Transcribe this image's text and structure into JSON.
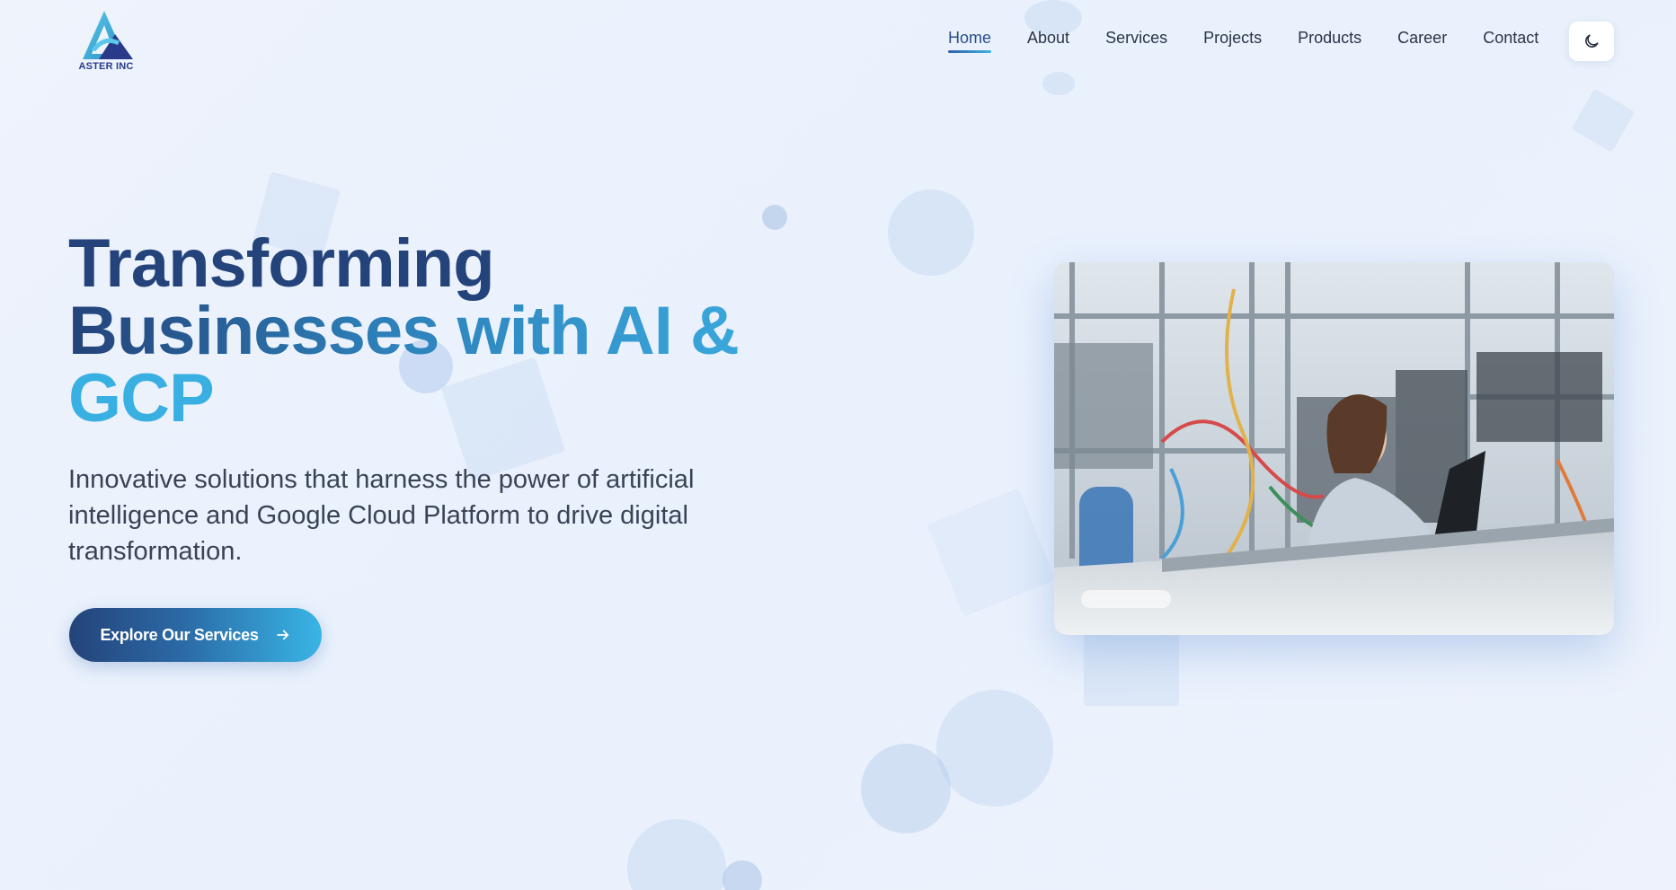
{
  "brand": {
    "logo_text": "ASTER INC",
    "colors": {
      "navy": "#24437a",
      "sky": "#39b0e2",
      "text": "#2b3445"
    }
  },
  "nav": {
    "items": [
      {
        "label": "Home",
        "active": true
      },
      {
        "label": "About",
        "active": false
      },
      {
        "label": "Services",
        "active": false
      },
      {
        "label": "Projects",
        "active": false
      },
      {
        "label": "Products",
        "active": false
      },
      {
        "label": "Career",
        "active": false
      },
      {
        "label": "Contact",
        "active": false
      }
    ],
    "theme_toggle_icon": "moon-icon"
  },
  "hero": {
    "title_line_1": "Transforming",
    "title_line_2": "Businesses with AI &",
    "title_line_3": "GCP",
    "subtitle": "Innovative solutions that harness the power of artificial intelligence and Google Cloud Platform to drive digital transformation.",
    "cta_label": "Explore Our Services",
    "cta_icon": "arrow-right-icon",
    "image_subject": "engineer-at-laptop-in-lab-photo"
  }
}
